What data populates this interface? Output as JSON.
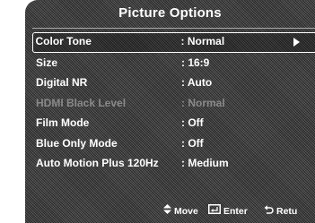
{
  "menu": {
    "title": "Picture Options",
    "items": [
      {
        "label": "Color Tone",
        "value": ": Normal",
        "selected": true,
        "enabled": true
      },
      {
        "label": "Size",
        "value": ": 16:9",
        "selected": false,
        "enabled": true
      },
      {
        "label": "Digital NR",
        "value": ": Auto",
        "selected": false,
        "enabled": true
      },
      {
        "label": "HDMI Black Level",
        "value": ": Normal",
        "selected": false,
        "enabled": false
      },
      {
        "label": "Film Mode",
        "value": ": Off",
        "selected": false,
        "enabled": true
      },
      {
        "label": "Blue Only Mode",
        "value": ": Off",
        "selected": false,
        "enabled": true
      },
      {
        "label": "Auto Motion Plus 120Hz",
        "value": ": Medium",
        "selected": false,
        "enabled": true
      }
    ]
  },
  "footer": {
    "move": {
      "icon": "up-down-icon",
      "label": "Move"
    },
    "enter": {
      "icon": "enter-icon",
      "label": "Enter"
    },
    "return": {
      "icon": "return-icon",
      "label": "Retu"
    }
  },
  "colors": {
    "background": "#454545",
    "text": "#ffffff",
    "disabled_text": "#8a8a8a",
    "selection_border": "#ffffff"
  }
}
